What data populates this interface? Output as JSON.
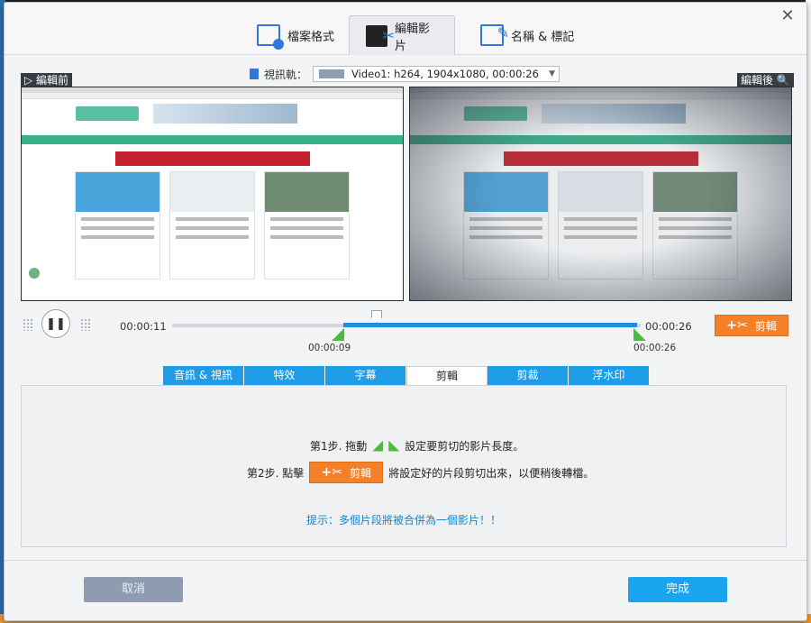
{
  "tabs": [
    {
      "label": "檔案格式",
      "icon": "file-settings-icon"
    },
    {
      "label": "編輯影片",
      "icon": "video-edit-icon",
      "active": true
    },
    {
      "label": "名稱 & 標記",
      "icon": "rename-tag-icon"
    }
  ],
  "preview": {
    "track_label": "視訊軌：",
    "track_value": "Video1: h264, 1904x1080, 00:00:26",
    "before_label": "▷ 編輯前",
    "after_label": "編輯後 🔍"
  },
  "playback": {
    "current_time": "00:00:11",
    "end_time": "00:00:26",
    "range_start": "00:00:09",
    "range_end": "00:00:26",
    "position_fraction": 0.42,
    "range_start_fraction": 0.35,
    "range_end_fraction": 1.0,
    "cut_label": "剪輯"
  },
  "sub_tabs": [
    "音訊 & 視訊",
    "特效",
    "字幕",
    "剪輯",
    "剪裁",
    "浮水印"
  ],
  "active_sub_tab": "剪輯",
  "instructions": {
    "step1_prefix": "第1步. 拖動",
    "step1_suffix": "設定要剪切的影片長度。",
    "step2_prefix": "第2步. 點擊",
    "step2_button": "剪輯",
    "step2_suffix": "將設定好的片段剪切出來，以便稍後轉檔。",
    "hint": "提示：多個片段將被合併為一個影片！！"
  },
  "footer": {
    "cancel": "取消",
    "done": "完成"
  },
  "colors": {
    "accent_blue": "#1e9ce8",
    "cut_orange": "#f4812a",
    "handle_green": "#4cbc3c"
  }
}
